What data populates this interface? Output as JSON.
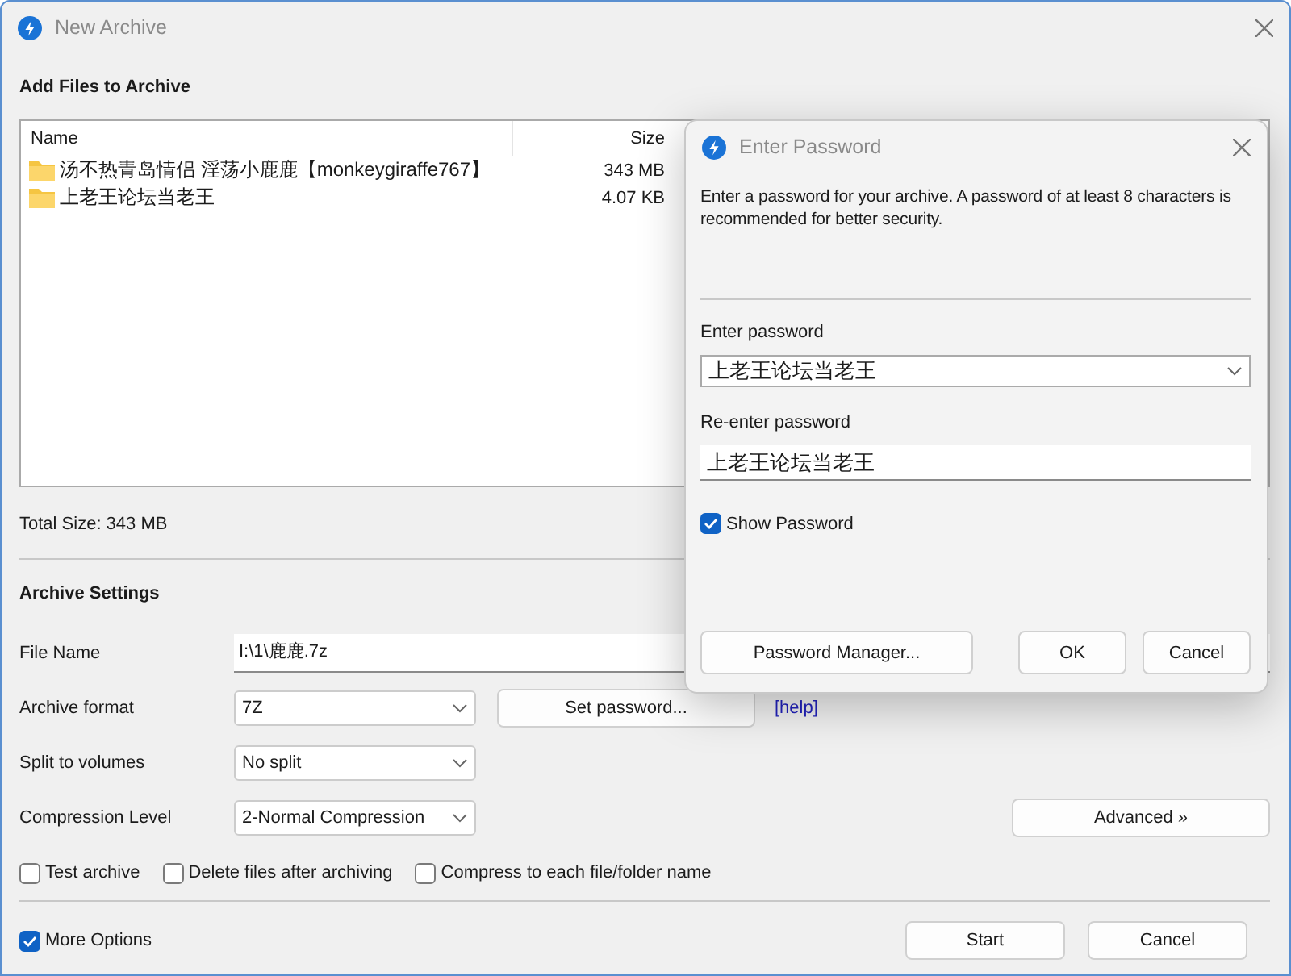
{
  "window": {
    "title": "New Archive"
  },
  "files": {
    "heading": "Add Files to Archive",
    "columns": [
      "Name",
      "Size"
    ],
    "rows": [
      {
        "name": "汤不热青岛情侣 淫荡小鹿鹿【monkeygiraffe767】",
        "size": "343 MB"
      },
      {
        "name": "上老王论坛当老王",
        "size": "4.07 KB"
      }
    ],
    "total_size": "Total Size: 343 MB"
  },
  "settings": {
    "heading": "Archive Settings",
    "file_name": {
      "label": "File Name",
      "value": "I:\\1\\鹿鹿.7z"
    },
    "archive_format": {
      "label": "Archive format",
      "value": "7Z"
    },
    "set_password_button": "Set password...",
    "help_link": "[help]",
    "split": {
      "label": "Split to volumes",
      "value": "No split"
    },
    "compression": {
      "label": "Compression Level",
      "value": "2-Normal Compression"
    },
    "advanced_button": "Advanced »"
  },
  "options": [
    {
      "label": "Test archive",
      "checked": false
    },
    {
      "label": "Delete files after archiving",
      "checked": false
    },
    {
      "label": "Compress to each file/folder name",
      "checked": false
    }
  ],
  "more_options": {
    "label": "More Options",
    "checked": true
  },
  "buttons": [
    "Start",
    "Cancel"
  ],
  "dialog": {
    "title": "Enter Password",
    "description": "Enter a password for your archive. A password of at least 8 characters is recommended for better security.",
    "password": {
      "label": "Enter password",
      "value": "上老王论坛当老王"
    },
    "reenter": {
      "label": "Re-enter password",
      "value": "上老王论坛当老王"
    },
    "show_password": {
      "label": "Show Password",
      "checked": true
    },
    "buttons": [
      "Password Manager...",
      "OK",
      "Cancel"
    ]
  }
}
